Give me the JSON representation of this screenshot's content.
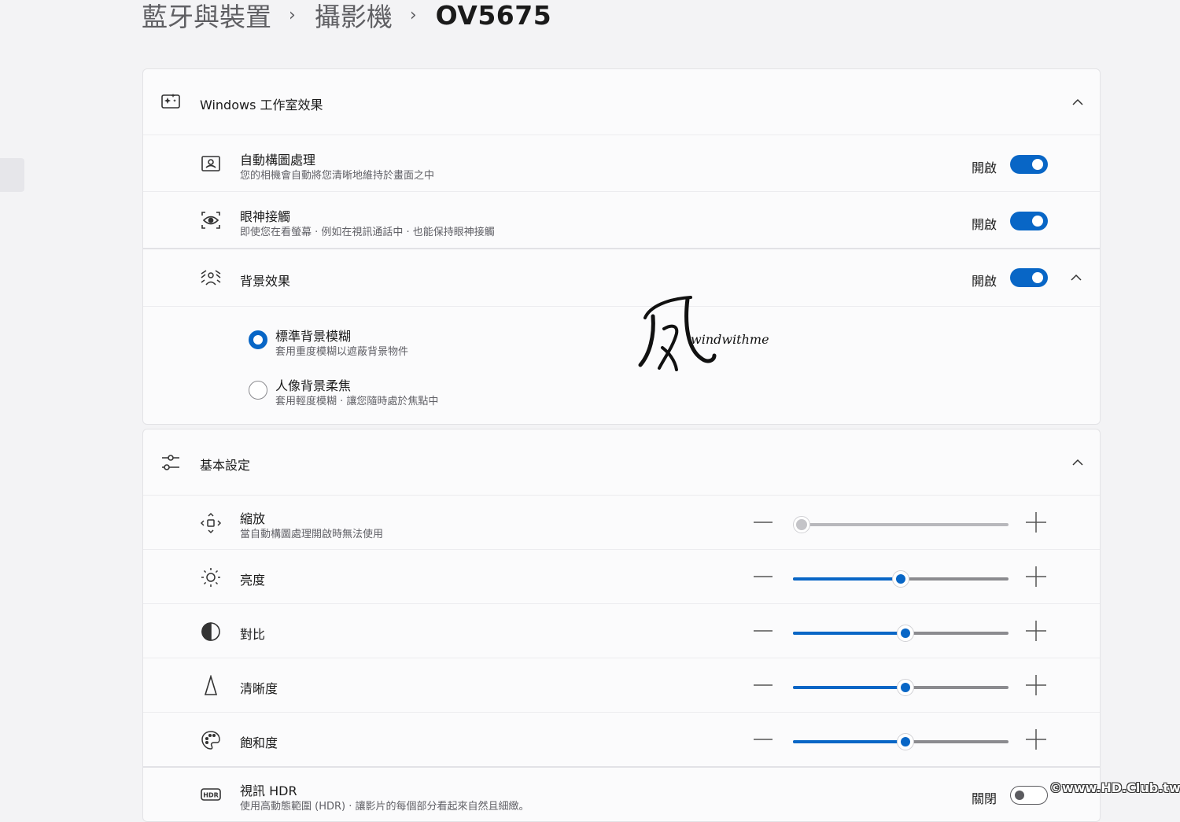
{
  "breadcrumb": {
    "items": [
      "藍牙與裝置",
      "攝影機"
    ],
    "separator": "›",
    "current": "OV5675"
  },
  "studio_effects": {
    "title": "Windows 工作室效果",
    "auto_framing": {
      "title": "自動構圖處理",
      "subtitle": "您的相機會自動將您清晰地維持於畫面之中",
      "state_label": "開啟",
      "on": true
    },
    "eye_contact": {
      "title": "眼神接觸",
      "subtitle": "即使您在看螢幕 · 例如在視訊通話中 · 也能保持眼神接觸",
      "state_label": "開啟",
      "on": true
    },
    "background_effects": {
      "title": "背景效果",
      "state_label": "開啟",
      "on": true,
      "options": [
        {
          "title": "標準背景模糊",
          "subtitle": "套用重度模糊以遮蔽背景物件",
          "selected": true
        },
        {
          "title": "人像背景柔焦",
          "subtitle": "套用輕度模糊 · 讓您隨時處於焦點中",
          "selected": false
        }
      ]
    }
  },
  "basic_settings": {
    "title": "基本設定",
    "zoom": {
      "title": "縮放",
      "subtitle": "當自動構圖處理開啟時無法使用",
      "value": 0,
      "enabled": false
    },
    "brightness": {
      "title": "亮度",
      "value": 48
    },
    "contrast": {
      "title": "對比",
      "value": 50
    },
    "sharpness": {
      "title": "清晰度",
      "value": 50
    },
    "saturation": {
      "title": "飽和度",
      "value": 50
    },
    "video_hdr": {
      "title": "視訊 HDR",
      "subtitle": "使用高動態範圍 (HDR) · 讓影片的每個部分看起來自然且細緻。",
      "state_label": "關閉",
      "on": false,
      "icon_text": "HDR"
    }
  },
  "watermark": {
    "logo_text": "windwithme",
    "copyright": "©www.HD.Club.tw"
  },
  "colors": {
    "accent": "#0866c6",
    "background": "#f3f3f5",
    "card": "#fbfbfc"
  }
}
